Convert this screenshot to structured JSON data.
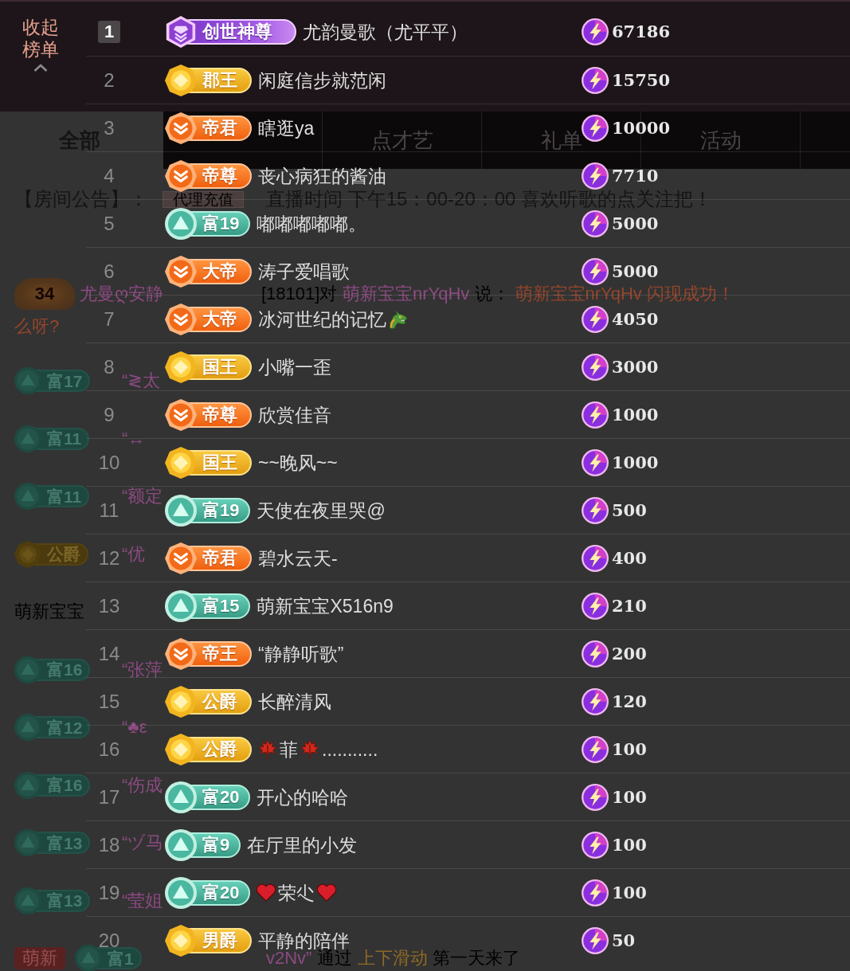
{
  "top_bar": {
    "collapse_button": "收起榜单"
  },
  "chat": {
    "category_tab": "全部",
    "tabs": [
      {
        "label": "点才艺",
        "selected": false
      },
      {
        "label": "礼单",
        "selected": false
      },
      {
        "label": "活动",
        "selected": false
      }
    ],
    "announcement": {
      "label": "【房间公告】：",
      "tag": "代理充值",
      "text": "直播时间 下午15：00-20：00 喜欢听歌的点关注把！"
    },
    "messages": [
      {
        "kind": "speech",
        "level": "34",
        "sender": "尤曼ღ安静",
        "segments": [
          {
            "kind": "plain",
            "text": "[18101]对"
          },
          {
            "kind": "name",
            "text": "萌新宝宝nrYqHv"
          },
          {
            "kind": "plain",
            "text": "说："
          },
          {
            "kind": "content",
            "text": "萌新宝宝nrYqHv 闪现成功！"
          }
        ],
        "continuation": "么呀?"
      },
      {
        "kind": "entry",
        "badges": [
          {
            "kind": "wealth",
            "label": "富17"
          }
        ],
        "segments": [
          {
            "kind": "name",
            "text": "“≷太"
          }
        ]
      },
      {
        "kind": "entry",
        "badges": [
          {
            "kind": "wealth",
            "label": "富11"
          }
        ],
        "segments": [
          {
            "kind": "name",
            "text": "“↔"
          }
        ]
      },
      {
        "kind": "entry",
        "badges": [
          {
            "kind": "wealth",
            "label": "富11"
          }
        ],
        "segments": [
          {
            "kind": "name",
            "text": "“额定"
          }
        ]
      },
      {
        "kind": "entry",
        "badges": [
          {
            "kind": "noble",
            "label": "公爵"
          }
        ],
        "segments": [
          {
            "kind": "name",
            "text": "“优"
          }
        ]
      },
      {
        "kind": "entry",
        "segments": [
          {
            "kind": "plain",
            "text": "萌新宝宝"
          }
        ]
      },
      {
        "kind": "entry",
        "badges": [
          {
            "kind": "wealth",
            "label": "富16"
          }
        ],
        "segments": [
          {
            "kind": "name",
            "text": "“张萍"
          }
        ]
      },
      {
        "kind": "entry",
        "badges": [
          {
            "kind": "wealth",
            "label": "富12"
          }
        ],
        "segments": [
          {
            "kind": "name",
            "text": "“♣ε"
          }
        ]
      },
      {
        "kind": "entry",
        "badges": [
          {
            "kind": "wealth",
            "label": "富16"
          }
        ],
        "segments": [
          {
            "kind": "name",
            "text": "“伤成"
          }
        ]
      },
      {
        "kind": "entry",
        "badges": [
          {
            "kind": "wealth",
            "label": "富13"
          }
        ],
        "segments": [
          {
            "kind": "name",
            "text": "“ヅ马"
          }
        ]
      },
      {
        "kind": "entry",
        "badges": [
          {
            "kind": "wealth",
            "label": "富13"
          }
        ],
        "segments": [
          {
            "kind": "name",
            "text": "“莹姐"
          }
        ]
      },
      {
        "kind": "notice",
        "badges": [
          {
            "kind": "newbie",
            "label": "萌新"
          },
          {
            "kind": "wealth",
            "label": "富1"
          }
        ],
        "segments": [
          {
            "kind": "name",
            "text": "v2Nv”"
          },
          {
            "kind": "plain",
            "text": "通过"
          },
          {
            "kind": "accent",
            "text": "上下滑动"
          },
          {
            "kind": "plain",
            "text": "第一天来了"
          }
        ]
      }
    ]
  },
  "leaderboard": {
    "rows": [
      {
        "rank": "1",
        "highlighted": true,
        "badge": {
          "kind": "mythic",
          "label": "创世神尊"
        },
        "name_parts": [
          {
            "kind": "text",
            "text": "尤韵曼歌（尤平平）"
          }
        ],
        "score": "67186"
      },
      {
        "rank": "2",
        "highlighted": false,
        "badge": {
          "kind": "noble",
          "label": "郡王"
        },
        "name_parts": [
          {
            "kind": "text",
            "text": "闲庭信步就范闲"
          }
        ],
        "score": "15750"
      },
      {
        "rank": "3",
        "highlighted": false,
        "badge": {
          "kind": "emperor",
          "label": "帝君"
        },
        "name_parts": [
          {
            "kind": "text",
            "text": "瞎逛ya"
          }
        ],
        "score": "10000"
      },
      {
        "rank": "4",
        "highlighted": false,
        "badge": {
          "kind": "emperor",
          "label": "帝尊"
        },
        "name_parts": [
          {
            "kind": "text",
            "text": "丧心病狂的酱油"
          }
        ],
        "score": "7710"
      },
      {
        "rank": "5",
        "highlighted": false,
        "badge": {
          "kind": "wealth",
          "label": "富19"
        },
        "name_parts": [
          {
            "kind": "text",
            "text": "嘟嘟嘟嘟嘟。"
          }
        ],
        "score": "5000"
      },
      {
        "rank": "6",
        "highlighted": false,
        "badge": {
          "kind": "emperor",
          "label": "大帝"
        },
        "name_parts": [
          {
            "kind": "text",
            "text": "涛子爱唱歌"
          }
        ],
        "score": "5000"
      },
      {
        "rank": "7",
        "highlighted": false,
        "badge": {
          "kind": "emperor",
          "label": "大帝"
        },
        "name_parts": [
          {
            "kind": "text",
            "text": "冰河世纪的记忆"
          },
          {
            "kind": "dragon"
          }
        ],
        "score": "4050"
      },
      {
        "rank": "8",
        "highlighted": false,
        "badge": {
          "kind": "noble",
          "label": "国王"
        },
        "name_parts": [
          {
            "kind": "text",
            "text": "小嘴一歪"
          }
        ],
        "score": "3000"
      },
      {
        "rank": "9",
        "highlighted": false,
        "badge": {
          "kind": "emperor",
          "label": "帝尊"
        },
        "name_parts": [
          {
            "kind": "text",
            "text": "欣赏佳音"
          }
        ],
        "score": "1000"
      },
      {
        "rank": "10",
        "highlighted": false,
        "badge": {
          "kind": "noble",
          "label": "国王"
        },
        "name_parts": [
          {
            "kind": "text",
            "text": "~~晚风~~"
          }
        ],
        "score": "1000"
      },
      {
        "rank": "11",
        "highlighted": false,
        "badge": {
          "kind": "wealth",
          "label": "富19"
        },
        "name_parts": [
          {
            "kind": "text",
            "text": "天使在夜里哭@"
          }
        ],
        "score": "500"
      },
      {
        "rank": "12",
        "highlighted": false,
        "badge": {
          "kind": "emperor",
          "label": "帝君"
        },
        "name_parts": [
          {
            "kind": "text",
            "text": "碧水云天-"
          }
        ],
        "score": "400"
      },
      {
        "rank": "13",
        "highlighted": false,
        "badge": {
          "kind": "wealth",
          "label": "富15"
        },
        "name_parts": [
          {
            "kind": "text",
            "text": "萌新宝宝X516n9"
          }
        ],
        "score": "210"
      },
      {
        "rank": "14",
        "highlighted": false,
        "badge": {
          "kind": "emperor",
          "label": "帝王"
        },
        "name_parts": [
          {
            "kind": "text",
            "text": "“静静听歌”"
          }
        ],
        "score": "200"
      },
      {
        "rank": "15",
        "highlighted": false,
        "badge": {
          "kind": "noble",
          "label": "公爵"
        },
        "name_parts": [
          {
            "kind": "text",
            "text": "长醉清风"
          }
        ],
        "score": "120"
      },
      {
        "rank": "16",
        "highlighted": false,
        "badge": {
          "kind": "noble",
          "label": "公爵"
        },
        "name_parts": [
          {
            "kind": "leaf"
          },
          {
            "kind": "text",
            "text": "菲"
          },
          {
            "kind": "leaf"
          },
          {
            "kind": "text",
            "text": "..........."
          }
        ],
        "score": "100"
      },
      {
        "rank": "17",
        "highlighted": false,
        "badge": {
          "kind": "wealth",
          "label": "富20"
        },
        "name_parts": [
          {
            "kind": "text",
            "text": "开心的哈哈"
          }
        ],
        "score": "100"
      },
      {
        "rank": "18",
        "highlighted": false,
        "badge": {
          "kind": "wealth",
          "label": "富9"
        },
        "name_parts": [
          {
            "kind": "text",
            "text": "在厅里的小发"
          }
        ],
        "score": "100"
      },
      {
        "rank": "19",
        "highlighted": false,
        "badge": {
          "kind": "wealth",
          "label": "富20"
        },
        "name_parts": [
          {
            "kind": "heart"
          },
          {
            "kind": "text",
            "text": "荣尐"
          },
          {
            "kind": "heart"
          }
        ],
        "score": "100"
      },
      {
        "rank": "20",
        "highlighted": false,
        "badge": {
          "kind": "noble",
          "label": "男爵"
        },
        "name_parts": [
          {
            "kind": "text",
            "text": "平静的陪伴"
          }
        ],
        "score": "50"
      }
    ]
  }
}
